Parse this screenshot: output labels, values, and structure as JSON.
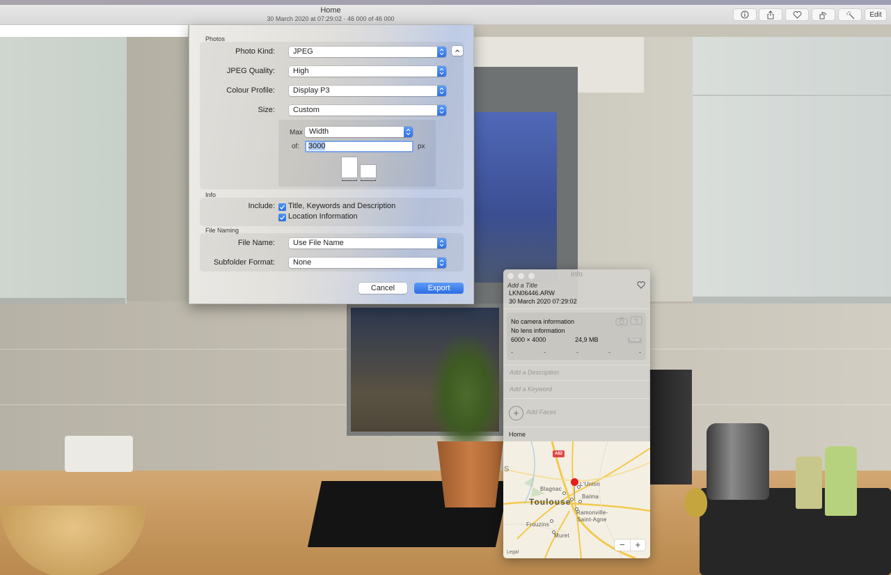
{
  "window": {
    "title": "Home",
    "subtitle": "30 March 2020 at 07:29:02  ·  46 000 of 46 000"
  },
  "toolbar": {
    "buttons": [
      {
        "name": "info-button",
        "icon": "info-icon",
        "glyph": "ⓘ"
      },
      {
        "name": "share-button",
        "icon": "share-icon",
        "glyph": "⬆"
      },
      {
        "name": "favorite-button",
        "icon": "heart-icon",
        "glyph": "♡"
      },
      {
        "name": "rotate-button",
        "icon": "rotate-icon",
        "glyph": "↺"
      },
      {
        "name": "auto-enhance-button",
        "icon": "magic-wand-icon",
        "glyph": "✨"
      }
    ],
    "edit_label": "Edit"
  },
  "export_sheet": {
    "sections": {
      "photos": "Photos",
      "info": "Info",
      "file_naming": "File Naming"
    },
    "photo_kind": {
      "label": "Photo Kind:",
      "value": "JPEG"
    },
    "jpeg_quality": {
      "label": "JPEG Quality:",
      "value": "High"
    },
    "colour_profile": {
      "label": "Colour Profile:",
      "value": "Display P3"
    },
    "size": {
      "label": "Size:",
      "value": "Custom"
    },
    "max": {
      "label": "Max",
      "value": "Width"
    },
    "of": {
      "label": "of:",
      "value": "3000",
      "unit": "px"
    },
    "include": {
      "label": "Include:",
      "options": [
        {
          "label": "Title, Keywords and Description",
          "checked": true
        },
        {
          "label": "Location Information",
          "checked": true
        }
      ]
    },
    "file_name": {
      "label": "File Name:",
      "value": "Use File Name"
    },
    "subfolder_format": {
      "label": "Subfolder Format:",
      "value": "None"
    },
    "cancel_label": "Cancel",
    "export_label": "Export",
    "accent_color": "#2f6fe3"
  },
  "info_panel": {
    "title": "Info",
    "add_title_placeholder": "Add a Title",
    "filename": "LKN06446.ARW",
    "datetime": "30 March 2020   07:29:02",
    "camera": "No camera information",
    "lens": "No lens information",
    "dimensions": "6000 × 4000",
    "filesize": "24,9 MB",
    "format_badge": "RAW",
    "exif_dashes": [
      "-",
      "-",
      "-",
      "-",
      "-"
    ],
    "description_placeholder": "Add a Description",
    "keyword_placeholder": "Add a Keyword",
    "add_faces_label": "Add Faces",
    "location": "Home",
    "map": {
      "road_badge": "A62",
      "edge_label": "S",
      "places": [
        {
          "name": "Toulouse",
          "major": true
        },
        {
          "name": "Blagnac"
        },
        {
          "name": "L'Union"
        },
        {
          "name": "Balma"
        },
        {
          "name": "Ramonville-"
        },
        {
          "name": "Saint-Agne"
        },
        {
          "name": "Frouzins"
        },
        {
          "name": "Muret"
        }
      ],
      "zoom_out": "−",
      "zoom_in": "+",
      "legal": "Legal",
      "pin_color": "#e51c1c"
    }
  }
}
